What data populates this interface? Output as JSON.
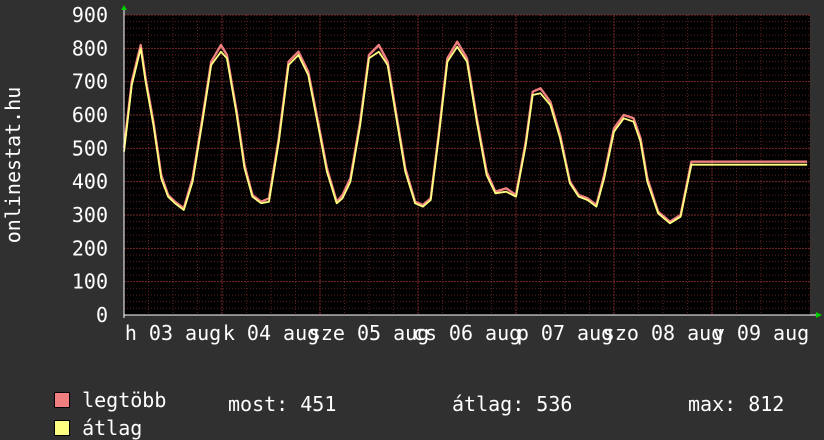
{
  "chart_data": {
    "type": "line",
    "ylabel": "onlinestat.hu",
    "ylim": [
      0,
      900
    ],
    "yticks": [
      0,
      100,
      200,
      300,
      400,
      500,
      600,
      700,
      800,
      900
    ],
    "xticks": [
      "h 03 aug",
      "k 04 aug",
      "sze 05 aug",
      "cs 06 aug",
      "p 07 aug",
      "szo 08 aug",
      "v 09 aug"
    ],
    "grid": true,
    "legend_position": "bottom-left",
    "colors": {
      "background": "#303030",
      "plot_background": "#000000",
      "grid": "#7a2a2a",
      "axis": "#ffffff",
      "legtobb": "#f08080",
      "atlag": "#ffff80"
    },
    "series": [
      {
        "name": "legtöbb",
        "anchors_x": [
          0.0,
          0.08,
          0.17,
          0.22,
          0.3,
          0.38,
          0.45,
          0.52,
          0.61,
          0.7,
          0.8,
          0.89,
          0.99,
          1.05,
          1.15,
          1.23,
          1.31,
          1.4,
          1.48,
          1.58,
          1.68,
          1.78,
          1.88,
          1.98,
          2.07,
          2.17,
          2.23,
          2.31,
          2.41,
          2.5,
          2.6,
          2.69,
          2.78,
          2.87,
          2.97,
          3.05,
          3.13,
          3.21,
          3.3,
          3.4,
          3.5,
          3.6,
          3.7,
          3.79,
          3.9,
          4.0,
          4.1,
          4.17,
          4.25,
          4.35,
          4.45,
          4.55,
          4.64,
          4.73,
          4.82,
          4.9,
          5.0,
          5.1,
          5.2,
          5.27,
          5.34,
          5.45,
          5.57,
          5.68,
          5.79,
          5.9,
          6.0,
          6.1,
          6.2,
          6.3,
          6.4,
          6.47,
          6.55,
          6.65,
          6.75,
          6.85,
          6.92,
          6.97
        ],
        "values": [
          500,
          700,
          810,
          710,
          580,
          420,
          360,
          340,
          320,
          410,
          590,
          760,
          810,
          780,
          610,
          450,
          360,
          340,
          350,
          530,
          760,
          790,
          730,
          580,
          440,
          340,
          360,
          410,
          580,
          780,
          810,
          760,
          600,
          440,
          340,
          330,
          350,
          540,
          770,
          820,
          770,
          590,
          430,
          370,
          380,
          360,
          520,
          670,
          680,
          640,
          540,
          400,
          360,
          350,
          330,
          420,
          560,
          600,
          590,
          530,
          410,
          310,
          280,
          300,
          460,
          460,
          460,
          460,
          460,
          460,
          460,
          460,
          460,
          460,
          460,
          460,
          460,
          460
        ]
      },
      {
        "name": "átlag",
        "anchors_x": [
          0.0,
          0.08,
          0.17,
          0.22,
          0.3,
          0.38,
          0.45,
          0.52,
          0.61,
          0.7,
          0.8,
          0.89,
          0.99,
          1.05,
          1.15,
          1.23,
          1.31,
          1.4,
          1.48,
          1.58,
          1.68,
          1.78,
          1.88,
          1.98,
          2.07,
          2.17,
          2.23,
          2.31,
          2.41,
          2.5,
          2.6,
          2.69,
          2.78,
          2.87,
          2.97,
          3.05,
          3.13,
          3.21,
          3.3,
          3.4,
          3.5,
          3.6,
          3.7,
          3.79,
          3.9,
          4.0,
          4.1,
          4.17,
          4.25,
          4.35,
          4.45,
          4.55,
          4.64,
          4.73,
          4.82,
          4.9,
          5.0,
          5.1,
          5.2,
          5.27,
          5.34,
          5.45,
          5.57,
          5.68,
          5.79,
          5.9,
          6.0,
          6.1,
          6.2,
          6.3,
          6.4,
          6.47,
          6.55,
          6.65,
          6.75,
          6.85,
          6.92,
          6.97
        ],
        "values": [
          490,
          690,
          800,
          700,
          570,
          410,
          355,
          335,
          315,
          400,
          580,
          750,
          790,
          770,
          600,
          440,
          355,
          335,
          340,
          520,
          750,
          780,
          720,
          570,
          430,
          335,
          350,
          400,
          570,
          770,
          790,
          750,
          590,
          430,
          335,
          325,
          345,
          530,
          760,
          805,
          760,
          580,
          420,
          365,
          370,
          355,
          510,
          660,
          665,
          630,
          530,
          395,
          355,
          345,
          325,
          410,
          550,
          590,
          580,
          520,
          400,
          305,
          275,
          295,
          451,
          451,
          451,
          451,
          451,
          451,
          451,
          451,
          451,
          451,
          451,
          451,
          451,
          451
        ]
      }
    ]
  },
  "legend": [
    {
      "label": "legtöbb",
      "color": "#f08080"
    },
    {
      "label": "átlag",
      "color": "#ffff80"
    }
  ],
  "stats": {
    "most": "most: 451",
    "atlag": "átlag: 536",
    "max": "max: 812"
  }
}
